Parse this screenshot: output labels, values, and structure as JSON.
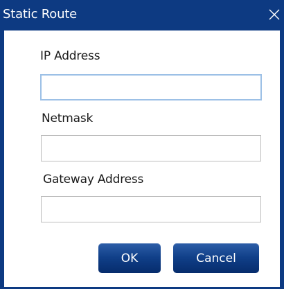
{
  "dialog": {
    "title": "Static Route",
    "close_icon": "close-icon"
  },
  "fields": {
    "ip_address": {
      "label": "IP Address",
      "value": ""
    },
    "netmask": {
      "label": "Netmask",
      "value": ""
    },
    "gateway_address": {
      "label": "Gateway Address",
      "value": ""
    }
  },
  "buttons": {
    "ok_label": "OK",
    "cancel_label": "Cancel"
  },
  "colors": {
    "titlebar": "#0d3a82",
    "button": "#103f88",
    "focus_border": "#9cc0e6"
  }
}
